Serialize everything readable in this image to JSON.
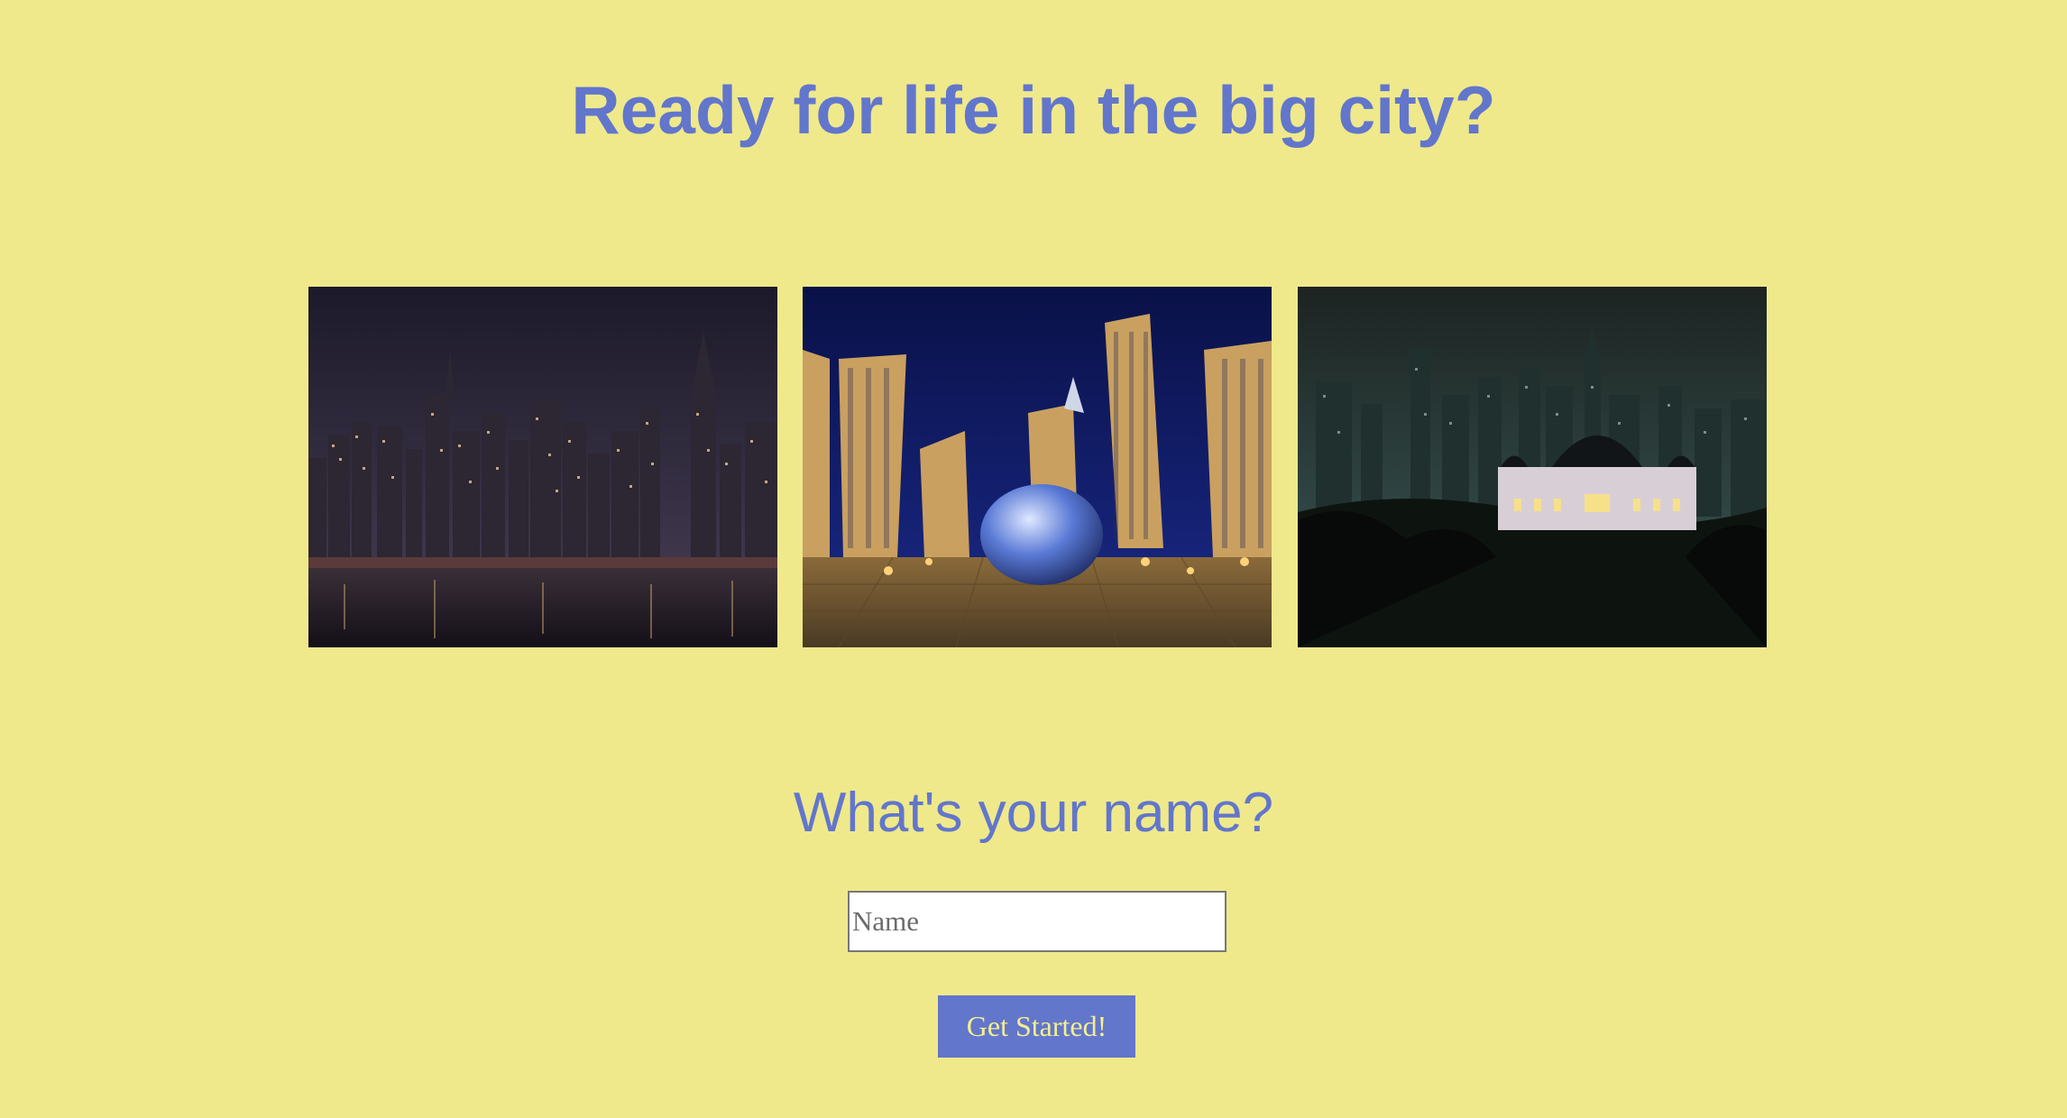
{
  "header": {
    "title": "Ready for life in the big city?"
  },
  "form": {
    "question": "What's your name?",
    "name_placeholder": "Name",
    "submit_label": "Get Started!"
  },
  "colors": {
    "background": "#efe98b",
    "accent": "#6276cc",
    "button_text": "#f4ee8f"
  }
}
